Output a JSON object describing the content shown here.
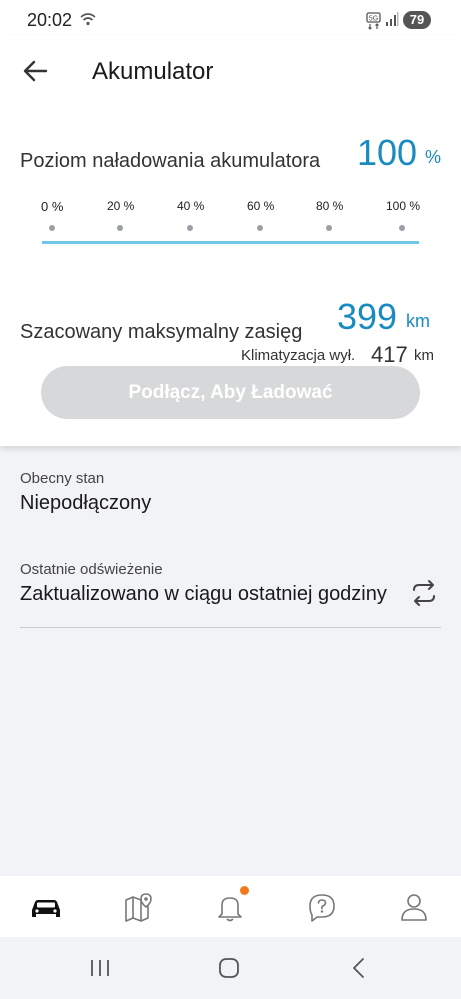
{
  "status_bar": {
    "time": "20:02",
    "battery": "79",
    "icons": [
      "wifi-icon",
      "volte-5g-icon",
      "signal-icon",
      "battery-icon"
    ]
  },
  "header": {
    "title": "Akumulator",
    "back_icon": "arrow-left-icon"
  },
  "battery_level": {
    "label": "Poziom naładowania akumulatora",
    "value": "100",
    "unit": "%",
    "percent": 100,
    "ticks": [
      "0 %",
      "20 %",
      "40 %",
      "60 %",
      "80 %",
      "100 %"
    ]
  },
  "range": {
    "label": "Szacowany maksymalny zasięg",
    "value": "399",
    "unit": "km",
    "ac_label": "Klimatyzacja wył.",
    "ac_value": "417",
    "ac_unit": "km"
  },
  "charge_button": {
    "label": "Podłącz, Aby Ładować",
    "disabled": true
  },
  "current_state": {
    "label": "Obecny stan",
    "value": "Niepodłączony"
  },
  "last_refresh": {
    "label": "Ostatnie odświeżenie",
    "value": "Zaktualizowano w ciągu ostatniej godziny",
    "icon": "refresh-icon"
  },
  "bottom_nav": {
    "items": [
      "car-icon",
      "map-icon",
      "bell-icon",
      "help-icon",
      "profile-icon"
    ],
    "active": "car-icon",
    "notification_badge": true
  },
  "system_nav": [
    "recents-icon",
    "home-icon",
    "back-icon"
  ],
  "colors": {
    "accent": "#1a8ac0",
    "progress": "#6ec6ea",
    "button_disabled": "#d7d8da",
    "badge": "#f07a1a",
    "background": "#f2f3f6"
  }
}
